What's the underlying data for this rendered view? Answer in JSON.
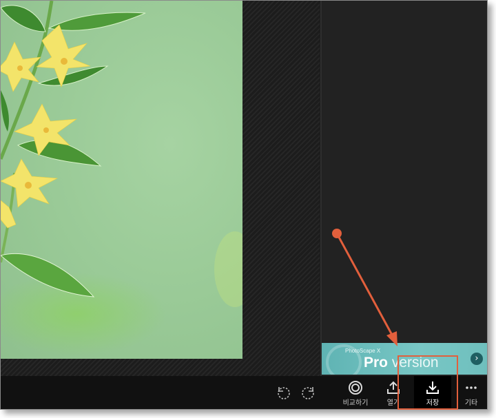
{
  "banner": {
    "small_text": "PhotoScape X",
    "pro_word": "Pro",
    "version_word": "version",
    "next_icon": "chevron-right-icon"
  },
  "toolbar": {
    "rotate_left_icon": "rotate-left-icon",
    "rotate_right_icon": "rotate-right-icon",
    "compare_label": "비교하기",
    "share_label": "열기",
    "save_label": "저장",
    "more_label": "기타"
  },
  "annotation": {
    "color": "#e25f3c"
  },
  "colors": {
    "toolbar_bg": "#111111",
    "banner_teal": "#6fbfbd",
    "panel_bg": "#222222"
  }
}
